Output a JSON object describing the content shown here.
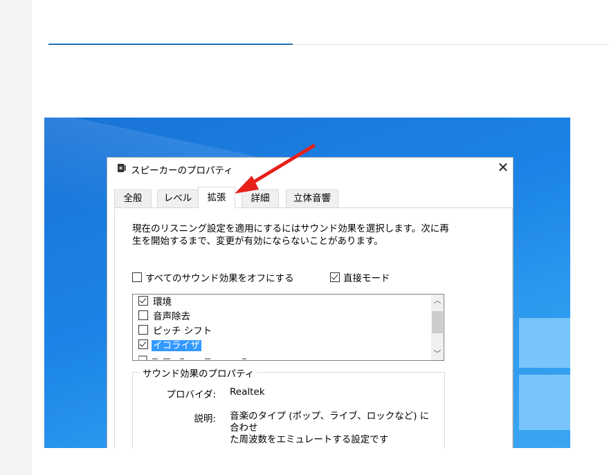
{
  "page": {
    "accent_blue": "#1f6fb0"
  },
  "dialog": {
    "title": "スピーカーのプロパティ",
    "close_glyph": "✕",
    "tabs": [
      {
        "label": "全般"
      },
      {
        "label": "レベル"
      },
      {
        "label": "拡張",
        "active": true
      },
      {
        "label": "詳細"
      },
      {
        "label": "立体音響"
      }
    ],
    "description_line1": "現在のリスニング設定を適用にするにはサウンド効果を選択します。次に再",
    "description_line2": "生を開始するまで、変更が有効にならないことがあります。",
    "disable_all_label": "すべてのサウンド効果をオフにする",
    "disable_all_checked": false,
    "direct_mode_label": "直接モード",
    "direct_mode_checked": true,
    "effects": [
      {
        "label": "環境",
        "checked": true
      },
      {
        "label": "音声除去",
        "checked": false
      },
      {
        "label": "ピッチ シフト",
        "checked": false
      },
      {
        "label": "イコライザ",
        "checked": true,
        "selected": true
      }
    ],
    "properties_group_title": "サウンド効果のプロパティ",
    "provider_key": "プロバイダ:",
    "provider_value": "Realtek",
    "description_key": "説明:",
    "description_value_line1": "音楽のタイプ (ポップ、ライブ、ロックなど) に合わせ",
    "description_value_line2": "た周波数をエミュレートする設定です"
  },
  "annotation": {
    "arrow_color": "#e8201a",
    "arrow_target": "tab-kakucho"
  }
}
